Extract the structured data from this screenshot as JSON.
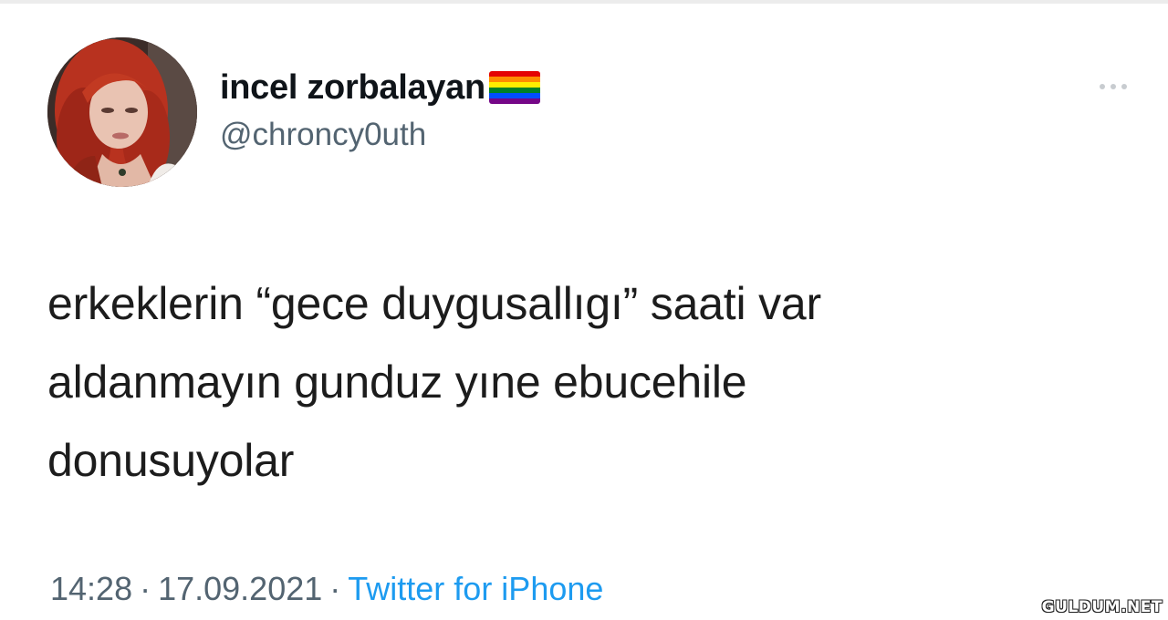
{
  "author": {
    "display_name": "incel zorbalayan",
    "handle": "@chroncy0uth",
    "badge_icon": "rainbow-flag-icon"
  },
  "tweet": {
    "lines": [
      "erkeklerin “gece duygusallıgı” saati var",
      "aldanmayın gunduz yıne ebucehile",
      "donusuyolar"
    ]
  },
  "meta": {
    "time": "14:28",
    "date": "17.09.2021",
    "separator": "·",
    "source": "Twitter for iPhone"
  },
  "menu": {
    "icon": "more-options-icon"
  },
  "watermark": {
    "text": "GULDUM.NET"
  },
  "colors": {
    "text": "#0f1419",
    "secondary": "#536471",
    "link": "#1d9bf0",
    "flag": [
      "#e40303",
      "#ff8c00",
      "#ffed00",
      "#008026",
      "#004dff",
      "#750787"
    ]
  }
}
